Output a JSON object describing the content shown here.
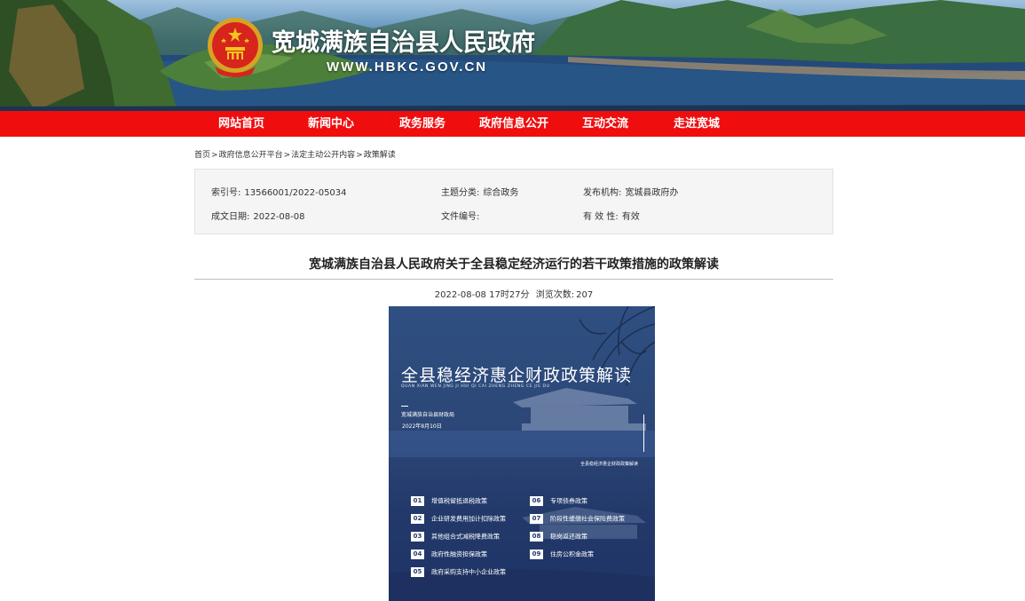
{
  "header": {
    "site_title": "宽城满族自治县人民政府",
    "domain": "WWW.HBKC.GOV.CN"
  },
  "nav": {
    "items": [
      {
        "label": "网站首页"
      },
      {
        "label": "新闻中心"
      },
      {
        "label": "政务服务"
      },
      {
        "label": "政府信息公开"
      },
      {
        "label": "互动交流"
      },
      {
        "label": "走进宽城"
      }
    ],
    "color": "#f00d0d"
  },
  "breadcrumb": {
    "items": [
      "首页",
      "政府信息公开平台",
      "法定主动公开内容",
      "政策解读"
    ],
    "separator": ">"
  },
  "meta": {
    "index_no": {
      "label": "索引号:",
      "value": "13566001/2022-05034"
    },
    "category": {
      "label": "主题分类:",
      "value": "综合政务"
    },
    "publisher": {
      "label": "发布机构:",
      "value": "宽城县政府办"
    },
    "date": {
      "label": "成文日期:",
      "value": "2022-08-08"
    },
    "doc_no": {
      "label": "文件编号:",
      "value": ""
    },
    "validity": {
      "label": "有 效 性:",
      "value": "有效"
    }
  },
  "article": {
    "title": "宽城满族自治县人民政府关于全县稳定经济运行的若干政策措施的政策解读",
    "datetime": "2022-08-08 17时27分",
    "views_label": "浏览次数:",
    "views": "207"
  },
  "poster": {
    "title": "全县稳经济惠企财政政策解读",
    "pinyin": "QUAN XIAN WEN JING JI HUI QI CAI ZHENG ZHENG CE JIE DU",
    "org": "宽城满族自治县财政局",
    "date": "2022年8月10日",
    "caption": "全县稳经济惠企财政政策解读",
    "items": [
      {
        "num": "01",
        "text": "增值税留抵退税政策"
      },
      {
        "num": "02",
        "text": "企业研发费用加计扣除政策"
      },
      {
        "num": "03",
        "text": "其他组合式减税降费政策"
      },
      {
        "num": "04",
        "text": "政府性融资担保政策"
      },
      {
        "num": "05",
        "text": "政府采购支持中小企业政策"
      },
      {
        "num": "06",
        "text": "专项债券政策"
      },
      {
        "num": "07",
        "text": "阶段性缓缴社会保险费政策"
      },
      {
        "num": "08",
        "text": "稳岗返还政策"
      },
      {
        "num": "09",
        "text": "住房公积金政策"
      }
    ]
  }
}
